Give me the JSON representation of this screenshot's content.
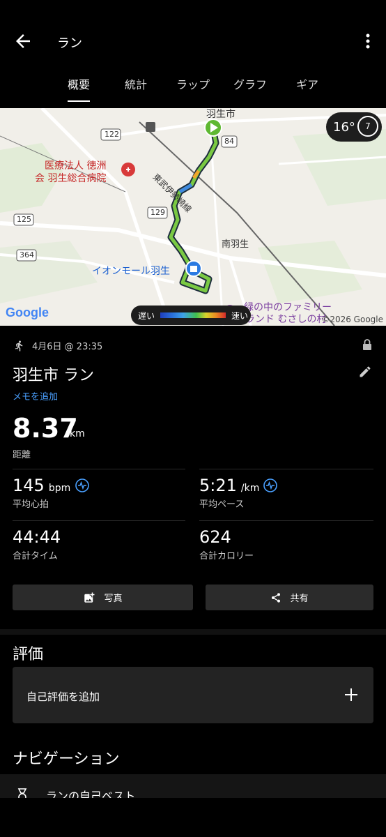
{
  "header": {
    "title": "ラン"
  },
  "tabs": [
    {
      "label": "概要"
    },
    {
      "label": "統計"
    },
    {
      "label": "ラップ"
    },
    {
      "label": "グラフ"
    },
    {
      "label": "ギア"
    }
  ],
  "map": {
    "weather": {
      "temp": "16°",
      "uv": "7"
    },
    "labels": {
      "hanyu_city": "羽生市",
      "hospital_line1": "医療法人 徳洲",
      "hospital_line2": "会 羽生総合病院",
      "railway": "東武伊勢崎線",
      "minami_hanyu": "南羽生",
      "aeon": "イオンモール羽生",
      "family_line1": "緑の中のファミリー",
      "family_line2": "ランド むさしの村",
      "route_122": "122",
      "route_84": "84",
      "route_129": "129",
      "route_125": "125",
      "route_364": "364"
    },
    "legend": {
      "slow": "遅い",
      "fast": "速い"
    },
    "google": "Google",
    "copyright": "©2026 Google"
  },
  "activity": {
    "date": "4月6日 @ 23:35",
    "title": "羽生市 ラン",
    "add_memo": "メモを追加",
    "distance": {
      "value": "8.37",
      "unit": "km",
      "label": "距離"
    },
    "heart_rate": {
      "value": "145",
      "unit": "bpm",
      "label": "平均心拍"
    },
    "pace": {
      "value": "5:21",
      "unit": "/km",
      "label": "平均ペース"
    },
    "total_time": {
      "value": "44:44",
      "label": "合計タイム"
    },
    "calories": {
      "value": "624",
      "label": "合計カロリー"
    }
  },
  "buttons": {
    "photo": "写真",
    "share": "共有"
  },
  "rating": {
    "title": "評価",
    "add_label": "自己評価を追加"
  },
  "navigation": {
    "title": "ナビゲーション",
    "item1": "ランの自己ベスト"
  },
  "colors": {
    "accent": "#4aa0ff",
    "route": "#7ac943",
    "background": "#000000"
  }
}
